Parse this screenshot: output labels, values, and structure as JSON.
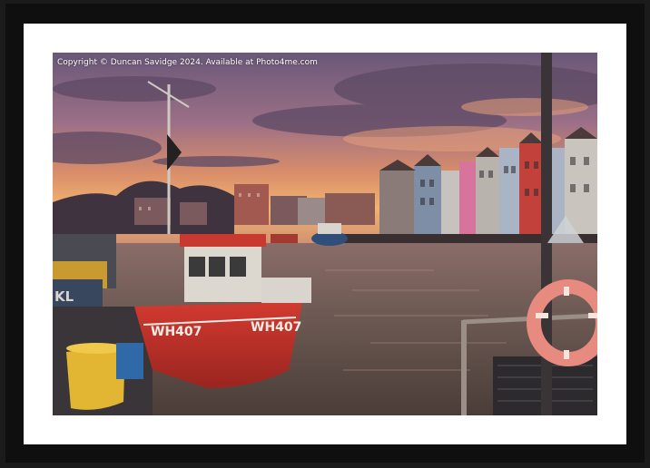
{
  "photo": {
    "copyright": "Copyright © Duncan Savidge 2024. Available at Photo4me.com",
    "boat_registration": "WH407",
    "hull_letters": "KL"
  },
  "colors": {
    "frame": "#1b1b1b",
    "mat": "#ffffff",
    "sky_top": "#6e5a7a",
    "sky_glow": "#f0a15a",
    "water": "#6e5a52",
    "boat_hull": "#c9302b"
  }
}
